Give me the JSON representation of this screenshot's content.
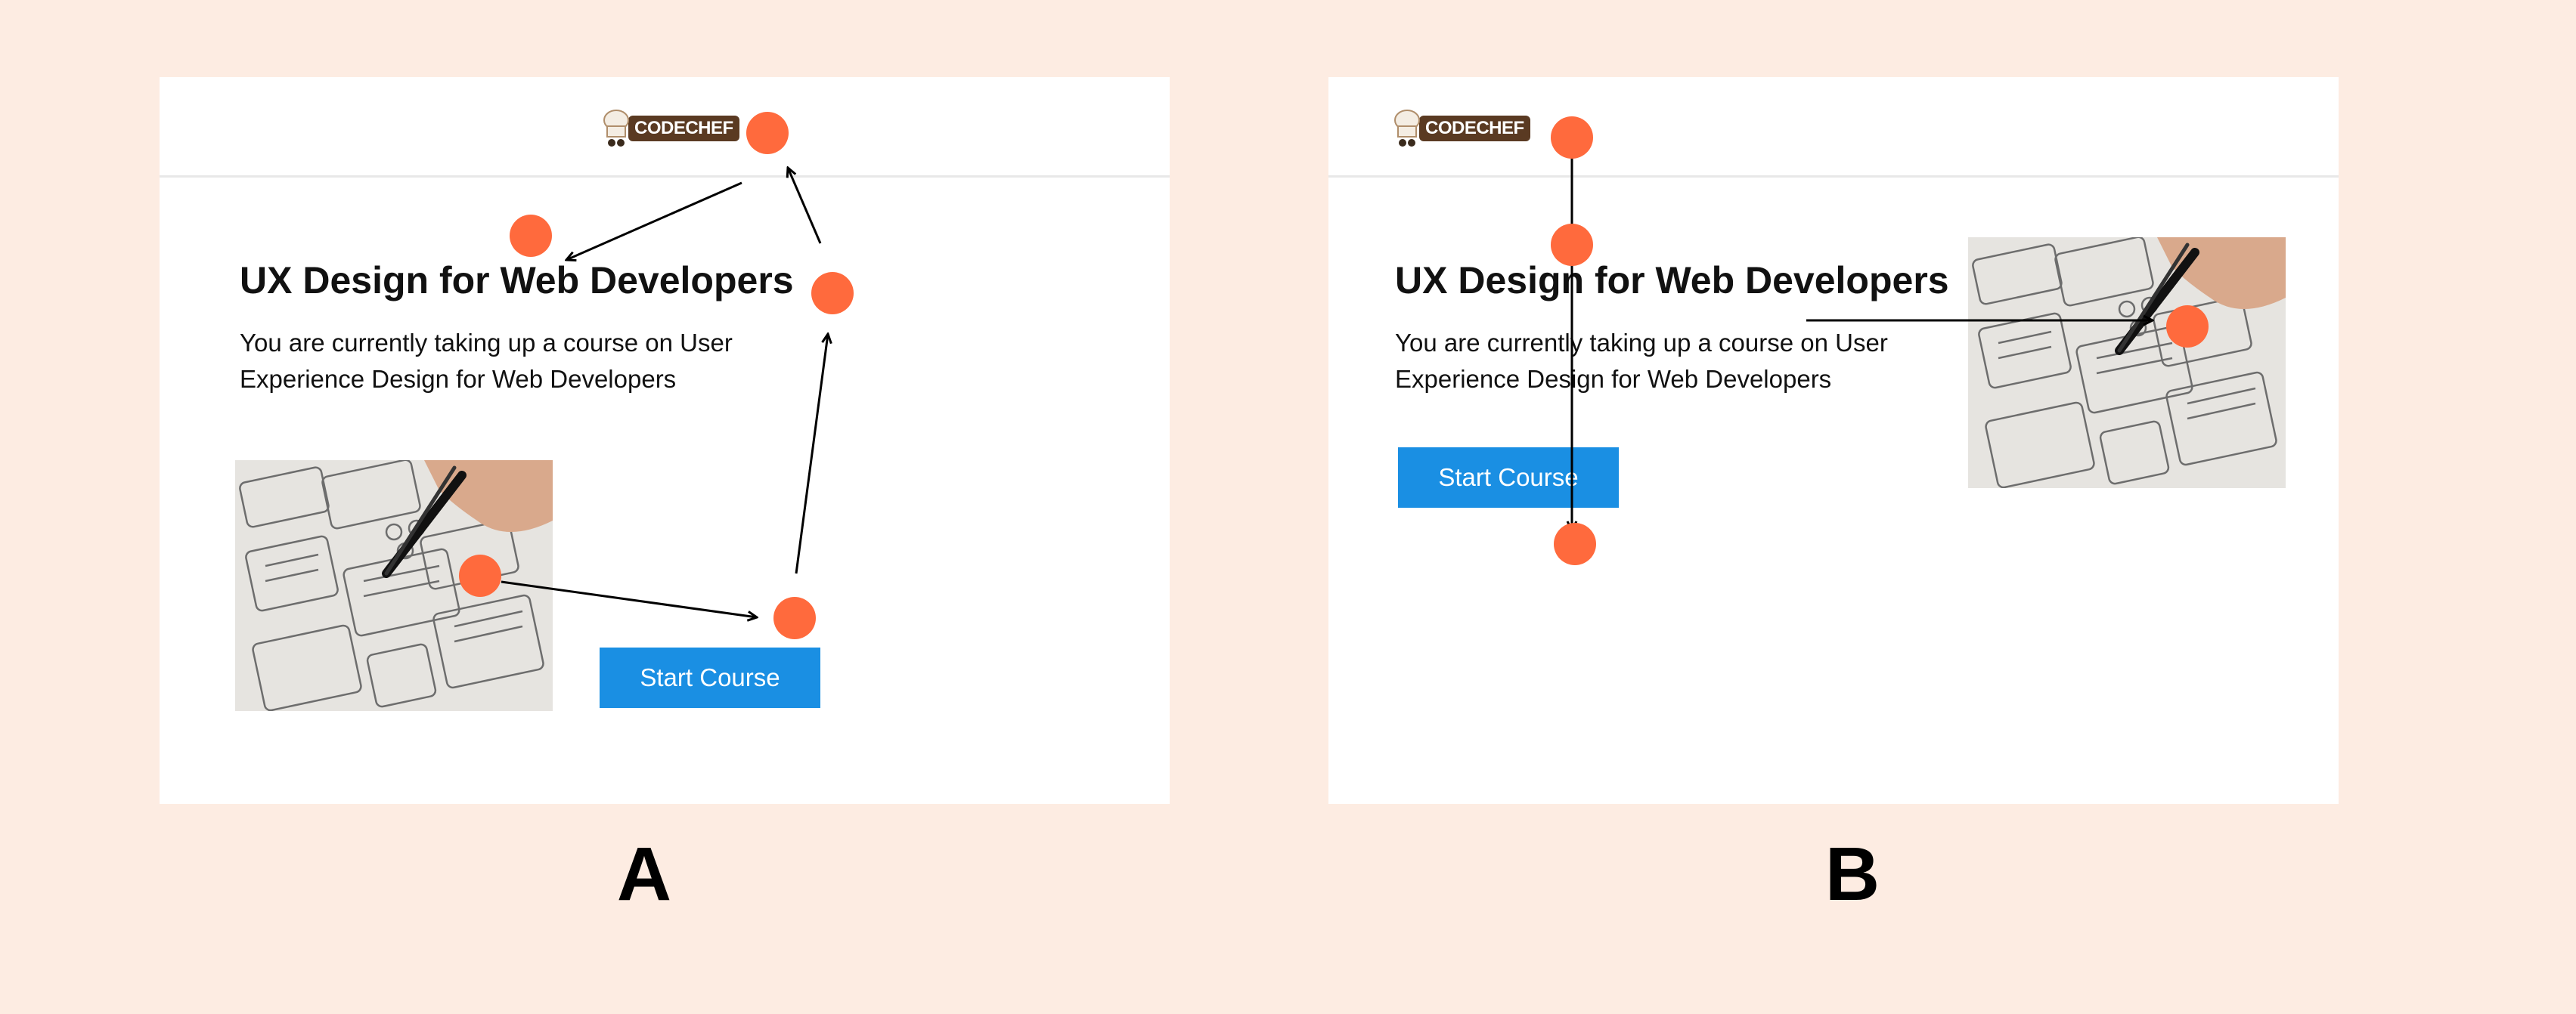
{
  "colors": {
    "background": "#fdece2",
    "accent_dot": "#ff6a3d",
    "button": "#1a8fe3",
    "logo_bg": "#5a3a22"
  },
  "logo": {
    "text": "CODECHEF",
    "icon": "chef-hat-icon"
  },
  "variants": [
    {
      "id": "A",
      "caption": "A",
      "course_title": "UX Design for Web Developers",
      "course_description": "You are currently taking up a course on User Experience Design for Web Developers",
      "cta_label": "Start Course"
    },
    {
      "id": "B",
      "caption": "B",
      "course_title": "UX Design for Web Developers",
      "course_description": "You are currently taking up a course on User Experience Design for Web Developers",
      "cta_label": "Start Course"
    }
  ]
}
